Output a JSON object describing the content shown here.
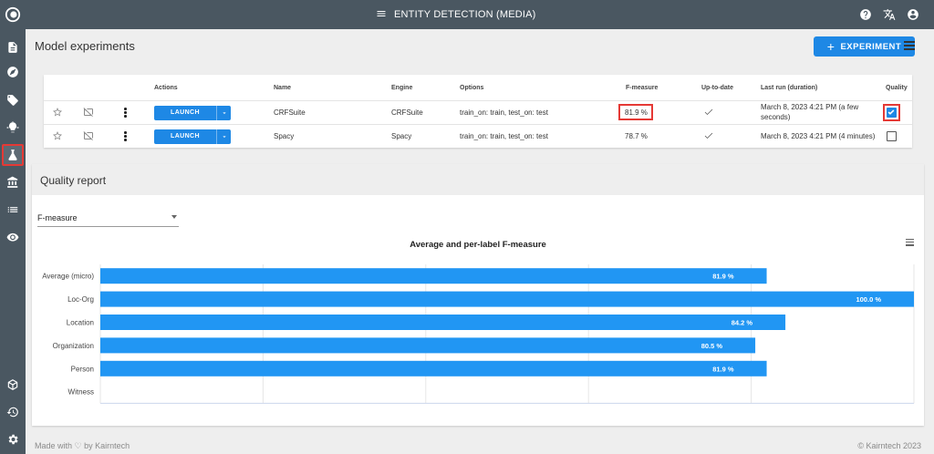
{
  "app": {
    "title": "ENTITY DETECTION (MEDIA)"
  },
  "header": {
    "title": "Model experiments",
    "add_button": "EXPERIMENT"
  },
  "table": {
    "columns": [
      "Actions",
      "Name",
      "Engine",
      "Options",
      "F-measure",
      "Up-to-date",
      "Last run (duration)",
      "Quality"
    ],
    "launch_label": "LAUNCH",
    "rows": [
      {
        "name": "CRFSuite",
        "engine": "CRFSuite",
        "options": "train_on: train, test_on: test",
        "fmeasure": "81.9 %",
        "last_run_1": "March 8, 2023 4:21 PM (a few",
        "last_run_2": "seconds)",
        "quality": true
      },
      {
        "name": "Spacy",
        "engine": "Spacy",
        "options": "train_on: train, test_on: test",
        "fmeasure": "78.7 %",
        "last_run_1": "March 8, 2023 4:21 PM (4 minutes)",
        "last_run_2": "",
        "quality": false
      }
    ]
  },
  "quality_report": {
    "title": "Quality report",
    "select_value": "F-measure"
  },
  "chart_data": {
    "type": "bar",
    "orientation": "horizontal",
    "title": "Average and per-label F-measure",
    "categories": [
      "Average (micro)",
      "Loc-Org",
      "Location",
      "Organization",
      "Person",
      "Witness"
    ],
    "values": [
      81.9,
      100.0,
      84.2,
      80.5,
      81.9,
      null
    ],
    "value_labels": [
      "81.9 %",
      "100.0 %",
      "84.2 %",
      "80.5 %",
      "81.9 %",
      ""
    ],
    "xlim": [
      0,
      100
    ],
    "color": "#2196f3",
    "grid": true,
    "legend": false
  },
  "footer": {
    "left": "Made with ♡ by Kairntech",
    "right": "©  Kairntech 2023"
  },
  "colors": {
    "rail": "#4a5761",
    "accent": "#1e88e5",
    "highlight": "#e53935"
  },
  "icons": {
    "rail": [
      "logo-icon",
      "document-icon",
      "compass-icon",
      "tag-icon",
      "lightbulb-icon",
      "flask-icon",
      "bank-icon",
      "list-icon",
      "eye-icon",
      "cube-icon",
      "history-icon",
      "settings-icon"
    ],
    "top": [
      "menu-icon",
      "help-icon",
      "translate-icon",
      "account-icon"
    ]
  }
}
